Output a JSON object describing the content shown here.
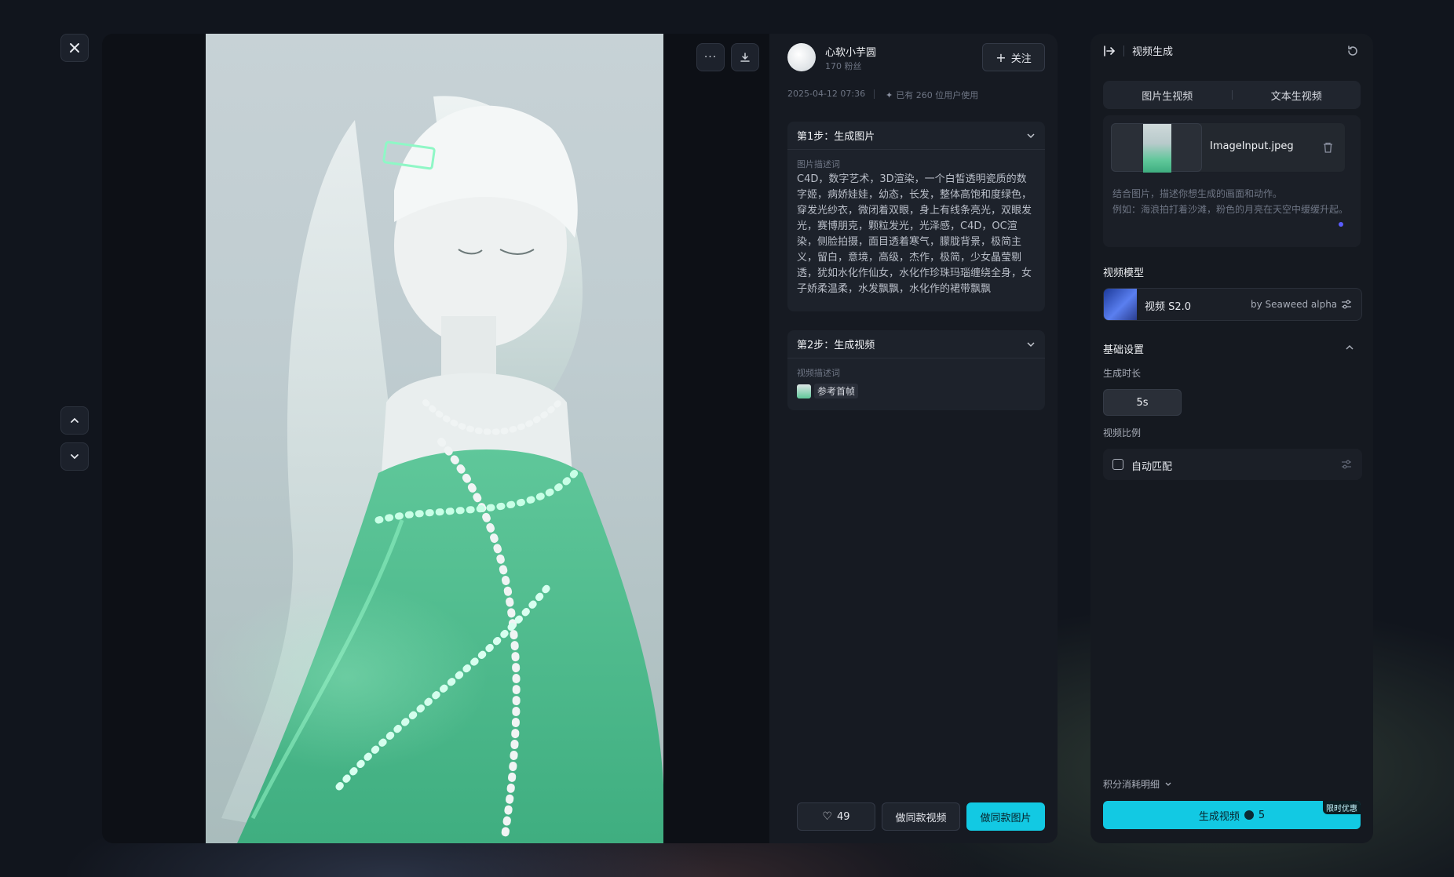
{
  "viewer": {
    "close_icon": "close-icon",
    "prev_icon": "chevron-up-icon",
    "next_icon": "chevron-down-icon",
    "more_icon": "more-icon",
    "download_icon": "download-icon",
    "image_alt": "green porcelain girl artwork"
  },
  "author": {
    "name": "心软小芋圆",
    "fans": "170 粉丝",
    "follow_label": "关注",
    "date": "2025-04-12 07:36",
    "usage": "已有 260 位用户使用"
  },
  "steps": [
    {
      "title": "第1步：生成图片",
      "label": "图片描述词",
      "prompt": "C4D，数字艺术，3D渲染，一个白皙透明瓷质的数字姬，病娇娃娃，幼态，长发，整体高饱和度绿色，穿发光纱衣，微闭着双眼，身上有线条亮光，双眼发光，赛博朋克，颗粒发光，光泽感，C4D，OC渲染，侧脸拍摄，面目透着寒气，朦胧背景，极简主义，留白，意境，高级，杰作，极简，少女晶莹剔透，犹如水化作仙女，水化作珍珠玛瑙缠绕全身，女子娇柔温柔，水发飘飘，水化作的裙带飘飘"
    },
    {
      "title": "第2步：生成视频",
      "label": "视频描述词",
      "ref_label": "参考首帧"
    }
  ],
  "actions": {
    "likes": "49",
    "same_video": "做同款视频",
    "same_image": "做同款图片"
  },
  "generator": {
    "title": "视频生成",
    "tabs": [
      "图片生视频",
      "文本生视频"
    ],
    "file_name": "ImageInput.jpeg",
    "hint_line1": "结合图片，描述你想生成的画面和动作。",
    "hint_line2": "例如：海浪拍打着沙滩，粉色的月亮在天空中缓缓升起。",
    "model_section": "视频模型",
    "model_name": "视频 S2.0",
    "model_by": "by Seaweed alpha",
    "basic_section": "基础设置",
    "duration_label": "生成时长",
    "duration_value": "5s",
    "ratio_label": "视频比例",
    "ratio_value": "自动匹配",
    "cost_label": "积分消耗明细",
    "generate_label": "生成视频",
    "generate_cost": "5",
    "promo_badge": "限时优惠"
  },
  "colors": {
    "accent": "#12c9e3",
    "panel": "#151920",
    "card": "#1d222b"
  }
}
